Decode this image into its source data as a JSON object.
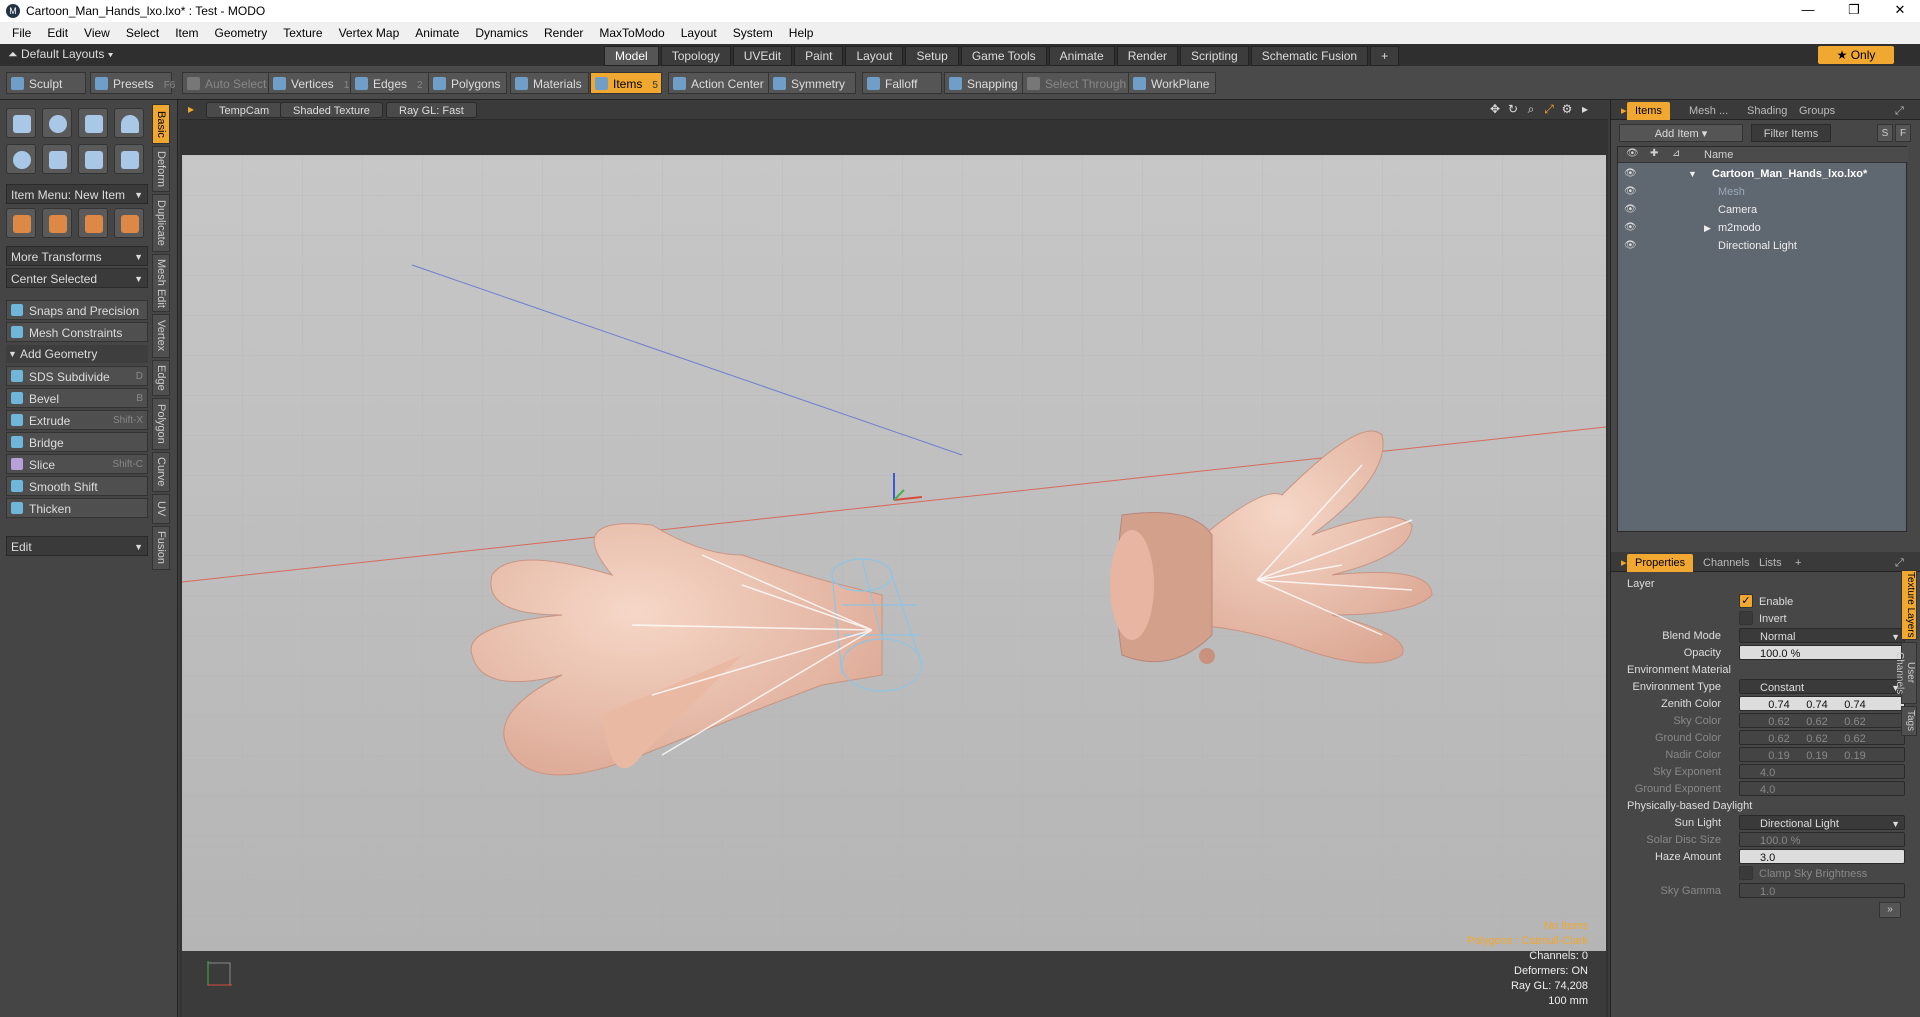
{
  "window": {
    "title": "Cartoon_Man_Hands_lxo.lxo* : Test - MODO",
    "logo": "MODO"
  },
  "menu": [
    "File",
    "Edit",
    "View",
    "Select",
    "Item",
    "Geometry",
    "Texture",
    "Vertex Map",
    "Animate",
    "Dynamics",
    "Render",
    "MaxToModo",
    "Layout",
    "System",
    "Help"
  ],
  "layouts": {
    "label": "Default Layouts",
    "tabs": [
      "Model",
      "Topology",
      "UVEdit",
      "Paint",
      "Layout",
      "Setup",
      "Game Tools",
      "Animate",
      "Render",
      "Scripting",
      "Schematic Fusion"
    ],
    "active": "Model",
    "only": "★ Only"
  },
  "toolbar": {
    "sculpt": "Sculpt",
    "presets": "Presets",
    "presets_key": "F6",
    "auto_select": "Auto Select",
    "vertices": "Vertices",
    "vertices_num": "1",
    "edges": "Edges",
    "edges_num": "2",
    "polygons": "Polygons",
    "materials": "Materials",
    "items": "Items",
    "items_num": "5",
    "action_center": "Action Center",
    "symmetry": "Symmetry",
    "falloff": "Falloff",
    "snapping": "Snapping",
    "select_through": "Select Through",
    "workplane": "WorkPlane"
  },
  "left": {
    "item_menu": "Item Menu: New Item",
    "more_transforms": "More Transforms",
    "center_selected": "Center Selected",
    "snaps": "Snaps and Precision",
    "mesh_constraints": "Mesh Constraints",
    "add_geometry": "Add Geometry",
    "tools": [
      {
        "label": "SDS Subdivide",
        "key": "D"
      },
      {
        "label": "Bevel",
        "key": "B"
      },
      {
        "label": "Extrude",
        "key": "Shift-X"
      },
      {
        "label": "Bridge",
        "key": ""
      },
      {
        "label": "Slice",
        "key": "Shift-C"
      },
      {
        "label": "Smooth Shift",
        "key": ""
      },
      {
        "label": "Thicken",
        "key": ""
      }
    ],
    "edit": "Edit",
    "vtabs": [
      "Basic",
      "Deform",
      "Duplicate",
      "Mesh Edit",
      "Vertex",
      "Edge",
      "Polygon",
      "Curve",
      "UV",
      "Fusion"
    ]
  },
  "viewport": {
    "camera": "TempCam",
    "shading": "Shaded Texture",
    "raygl": "Ray GL: Fast",
    "info": [
      "No Items",
      "Polygons : Catmull-Clark",
      "Channels: 0",
      "Deformers: ON",
      "Ray GL: 74,208",
      "100 mm"
    ]
  },
  "items_panel": {
    "tabs": [
      "Items",
      "Mesh ...",
      "Shading",
      "Groups"
    ],
    "add_item": "Add Item",
    "filter": "Filter Items",
    "s": "S",
    "f": "F",
    "col_name": "Name",
    "rows": [
      {
        "name": "Cartoon_Man_Hands_lxo.lxo*",
        "indent": 0,
        "bold": true
      },
      {
        "name": "Mesh",
        "indent": 1,
        "dim": true
      },
      {
        "name": "Camera",
        "indent": 1
      },
      {
        "name": "m2modo",
        "indent": 1
      },
      {
        "name": "Directional Light",
        "indent": 1
      }
    ]
  },
  "props": {
    "tabs": [
      "Properties",
      "Channels",
      "Lists",
      "+"
    ],
    "layer": "Layer",
    "enable": "Enable",
    "invert": "Invert",
    "blend_label": "Blend Mode",
    "blend": "Normal",
    "opacity_label": "Opacity",
    "opacity": "100.0 %",
    "env_material": "Environment Material",
    "env_type_label": "Environment Type",
    "env_type": "Constant",
    "colors": [
      {
        "label": "Zenith Color",
        "v": [
          "0.74",
          "0.74",
          "0.74"
        ],
        "dim": false
      },
      {
        "label": "Sky Color",
        "v": [
          "0.62",
          "0.62",
          "0.62"
        ],
        "dim": true
      },
      {
        "label": "Ground Color",
        "v": [
          "0.62",
          "0.62",
          "0.62"
        ],
        "dim": true
      },
      {
        "label": "Nadir Color",
        "v": [
          "0.19",
          "0.19",
          "0.19"
        ],
        "dim": true
      }
    ],
    "sky_exp_label": "Sky Exponent",
    "sky_exp": "4.0",
    "ground_exp_label": "Ground Exponent",
    "ground_exp": "4.0",
    "daylight": "Physically-based Daylight",
    "sun_label": "Sun Light",
    "sun": "Directional Light",
    "disc_label": "Solar Disc Size",
    "disc": "100.0 %",
    "haze_label": "Haze Amount",
    "haze": "3.0",
    "clamp": "Clamp Sky Brightness",
    "gamma_label": "Sky Gamma",
    "gamma": "1.0",
    "vtabs": [
      "Texture Layers",
      "User Channels",
      "Tags"
    ]
  }
}
